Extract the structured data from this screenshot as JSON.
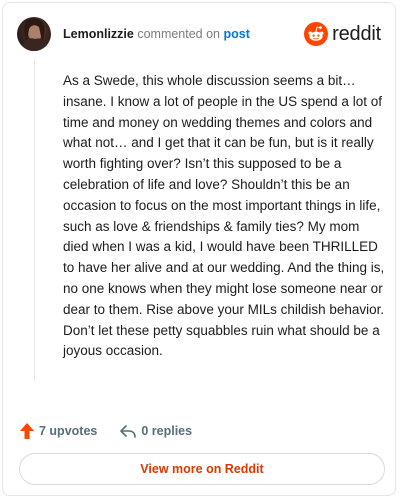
{
  "comment": {
    "username": "Lemonlizzie",
    "action_text": "commented on",
    "post_link": "post",
    "body": "As a Swede, this whole discussion seems a bit… insane. I know a lot of people in the US spend a lot of time and money on wedding themes and colors and what not… and I get that it can be fun, but is it really worth fighting over? Isn’t this supposed to be a celebration of life and love? Shouldn’t this be an occasion to focus on the most important things in life, such as love & friendships & family ties? My mom died when I was a kid, I would have been THRILLED to have her alive and at our wedding. And the thing is, no one knows when they might lose someone near or dear to them. Rise above your MILs childish behavior. Don’t let these petty squabbles ruin what should be a joyous occasion."
  },
  "brand": {
    "name": "reddit",
    "icon": "reddit-logo-icon",
    "color": "#ff4500"
  },
  "footer": {
    "upvotes": "7 upvotes",
    "replies": "0 replies",
    "upvote_icon": "upvote-arrow-icon",
    "reply_icon": "reply-arrow-icon"
  },
  "cta": {
    "label": "View more on Reddit",
    "color": "#d93a00"
  }
}
